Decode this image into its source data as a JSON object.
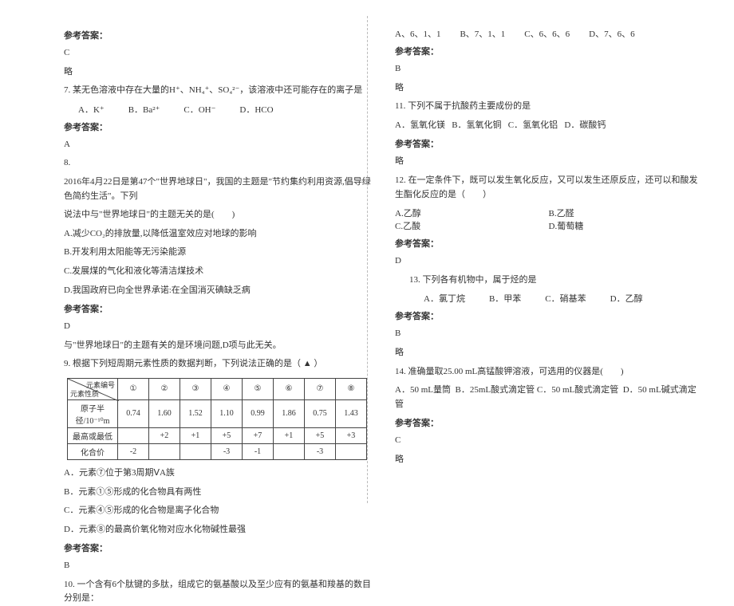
{
  "left": {
    "ans_heading": "参考答案：",
    "q6_ans": "C",
    "omit": "略",
    "q7_text": "7. 某无色溶液中存在大量的H⁺、NH₄⁺、SO₄²⁻，该溶液中还可能存在的离子是",
    "q7_A": "A．K⁺",
    "q7_B": "B．Ba²⁺",
    "q7_C": "C．OH⁻",
    "q7_D": "D．HCO",
    "q7_ans": "A",
    "q8_num": "8.",
    "q8_l1": "2016年4月22日是第47个\"世界地球日\"，我国的主题是\"节约集约利用资源,倡导绿色简约生活\"。下列",
    "q8_l2": "说法中与\"世界地球日\"的主题无关的是(　　)",
    "q8_A": "A.减少CO₂的排放量,以降低温室效应对地球的影响",
    "q8_B": "B.开发利用太阳能等无污染能源",
    "q8_C": "C.发展煤的气化和液化等清洁煤技术",
    "q8_D": "D.我国政府已向全世界承诺:在全国消灭碘缺乏病",
    "q8_ans": "D",
    "q8_expl": "与\"世界地球日\"的主题有关的是环境问题,D项与此无关。",
    "q9_text": "9. 根据下列短周期元素性质的数据判断，下列说法正确的是（  ▲  ）",
    "table": {
      "diag_a": "元素编号",
      "diag_b": "元素性质",
      "cols": [
        "①",
        "②",
        "③",
        "④",
        "⑤",
        "⑥",
        "⑦",
        "⑧"
      ],
      "rows": [
        {
          "h": "原子半径/10⁻¹⁰m",
          "v": [
            "0.74",
            "1.60",
            "1.52",
            "1.10",
            "0.99",
            "1.86",
            "0.75",
            "1.43"
          ]
        },
        {
          "h": "最高或最低",
          "v": [
            "",
            "+2",
            "+1",
            "+5",
            "+7",
            "+1",
            "+5",
            "+3"
          ]
        },
        {
          "h": "化合价",
          "v": [
            "-2",
            "",
            "",
            "-3",
            "-1",
            "",
            "-3",
            ""
          ]
        }
      ]
    },
    "q9_A": "A．元素⑦位于第3周期ⅤA族",
    "q9_B": "B．元素①⑤形成的化合物具有两性",
    "q9_C": "C．元素④⑤形成的化合物是离子化合物",
    "q9_D": "D．元素⑧的最高价氧化物对应水化物碱性最强",
    "q9_ans": "B",
    "q10_text": "10. 一个含有6个肽键的多肽，组成它的氨基酸以及至少应有的氨基和羧基的数目分别是："
  },
  "right": {
    "q10_A": "A、6、1、1",
    "q10_B": "B、7、1、1",
    "q10_C": "C、6、6、6",
    "q10_D": "D、7、6、6",
    "ans_heading": "参考答案：",
    "q10_ans": "B",
    "omit": "略",
    "q11_text": "11. 下列不属于抗酸药主要成份的是",
    "q11_A": "A．氢氧化镁",
    "q11_B": "B．氢氧化铜",
    "q11_C": "C．氢氧化铝",
    "q11_D": "D．碳酸钙",
    "q12_text": "12. 在一定条件下，既可以发生氧化反应，又可以发生还原反应，还可以和酸发生酯化反应的是（　　）",
    "q12_A": "A.乙醇",
    "q12_B": "B.乙醛",
    "q12_C": "C.乙酸",
    "q12_D": "D.葡萄糖",
    "q12_ans": "D",
    "q13_text": "13. 下列各有机物中，属于烃的是",
    "q13_A": "A．氯丁烷",
    "q13_B": "B．甲苯",
    "q13_C": "C．硝基苯",
    "q13_D": "D．乙醇",
    "q13_ans": "B",
    "q14_text": "14. 准确量取25.00 mL高锰酸钾溶液，可选用的仪器是(　　)",
    "q14_A": "A．50 mL量筒",
    "q14_B": "B．25mL酸式滴定管",
    "q14_C": "C．50 mL酸式滴定管",
    "q14_D": "D．50 mL碱式滴定管",
    "q14_ans": "C"
  }
}
